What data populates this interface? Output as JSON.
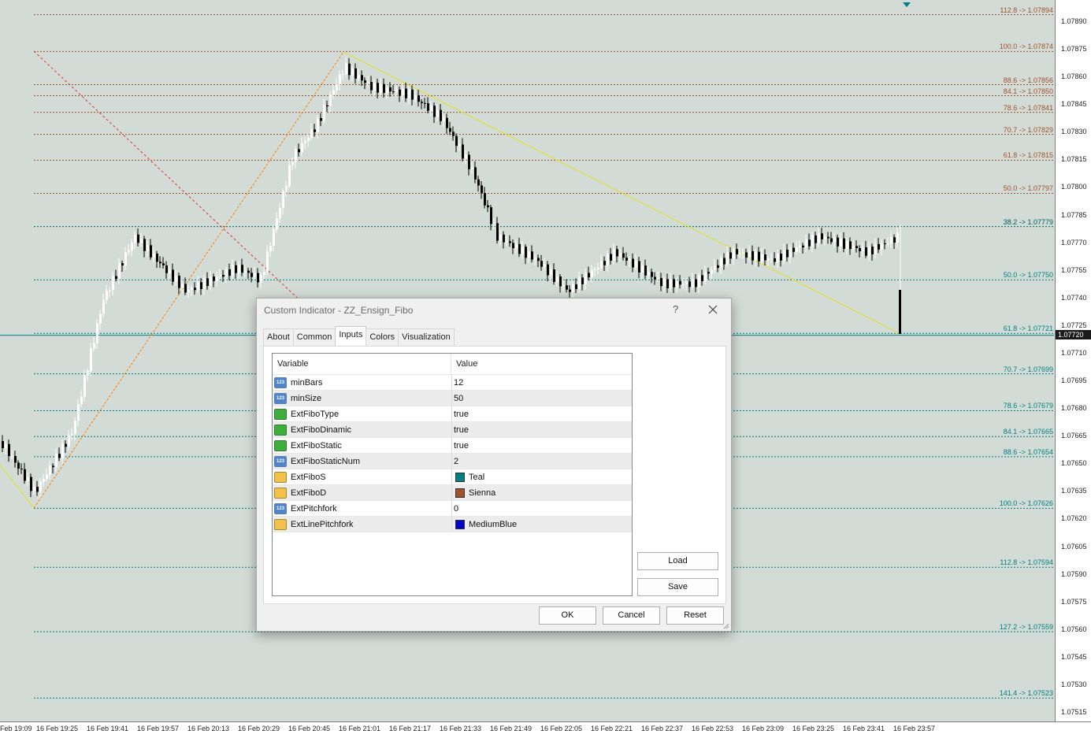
{
  "chart": {
    "price_labels": [
      "1.07890",
      "1.07875",
      "1.07860",
      "1.07845",
      "1.07830",
      "1.07815",
      "1.07800",
      "1.07785",
      "1.07770",
      "1.07755",
      "1.07740",
      "1.07725",
      "1.07710",
      "1.07695",
      "1.07680",
      "1.07665",
      "1.07650",
      "1.07635",
      "1.07620",
      "1.07605",
      "1.07590",
      "1.07575",
      "1.07560",
      "1.07545",
      "1.07530",
      "1.07515"
    ],
    "current_price": "1.07720",
    "time_labels": [
      "Feb 19:09",
      "16 Feb 19:25",
      "16 Feb 19:41",
      "16 Feb 19:57",
      "16 Feb 20:13",
      "16 Feb 20:29",
      "16 Feb 20:45",
      "16 Feb 21:01",
      "16 Feb 21:17",
      "16 Feb 21:33",
      "16 Feb 21:49",
      "16 Feb 22:05",
      "16 Feb 22:21",
      "16 Feb 22:37",
      "16 Feb 22:53",
      "16 Feb 23:09",
      "16 Feb 23:25",
      "16 Feb 23:41",
      "16 Feb 23:57"
    ],
    "fibo_sienna": [
      "112.8 -> 1.07894",
      "100.0 -> 1.07874",
      "88.6 -> 1.07856",
      "84.1 -> 1.07850",
      "78.6 -> 1.07841",
      "70.7 -> 1.07829",
      "61.8 -> 1.07815",
      "50.0 -> 1.07797",
      "38.2 -> 1.07779"
    ],
    "fibo_teal": [
      "38.2 -> 1.07779",
      "50.0 -> 1.07750",
      "61.8 -> 1.07721",
      "70.7 -> 1.07699",
      "78.6 -> 1.07679",
      "84.1 -> 1.07665",
      "88.6 -> 1.07654",
      "100.0 -> 1.07626",
      "112.8 -> 1.07594",
      "127.2 -> 1.07559",
      "141.4 -> 1.07523"
    ],
    "colors": {
      "background": "#d3dbd6",
      "sienna": "#a0522d",
      "teal": "#008080",
      "zigzag_up": "#ff7f00",
      "zigzag_down": "#e0e040",
      "cross": "#e03030"
    }
  },
  "dialog": {
    "title": "Custom Indicator - ZZ_Ensign_Fibo",
    "help": "?",
    "tabs": [
      "About",
      "Common",
      "Inputs",
      "Colors",
      "Visualization"
    ],
    "active_tab": "Inputs",
    "columns": {
      "variable": "Variable",
      "value": "Value"
    },
    "params": [
      {
        "name": "minBars",
        "value": "12",
        "type": "num"
      },
      {
        "name": "minSize",
        "value": "50",
        "type": "num"
      },
      {
        "name": "ExtFiboType",
        "value": "true",
        "type": "bool"
      },
      {
        "name": "ExtFiboDinamic",
        "value": "true",
        "type": "bool"
      },
      {
        "name": "ExtFiboStatic",
        "value": "true",
        "type": "bool"
      },
      {
        "name": "ExtFiboStaticNum",
        "value": "2",
        "type": "num"
      },
      {
        "name": "ExtFiboS",
        "value": "Teal",
        "type": "color",
        "color": "#008080"
      },
      {
        "name": "ExtFiboD",
        "value": "Sienna",
        "type": "color",
        "color": "#a0522d"
      },
      {
        "name": "ExtPitchfork",
        "value": "0",
        "type": "num"
      },
      {
        "name": "ExtLinePitchfork",
        "value": "MediumBlue",
        "type": "color",
        "color": "#0000cd"
      }
    ],
    "buttons": {
      "load": "Load",
      "save": "Save",
      "ok": "OK",
      "cancel": "Cancel",
      "reset": "Reset"
    }
  }
}
